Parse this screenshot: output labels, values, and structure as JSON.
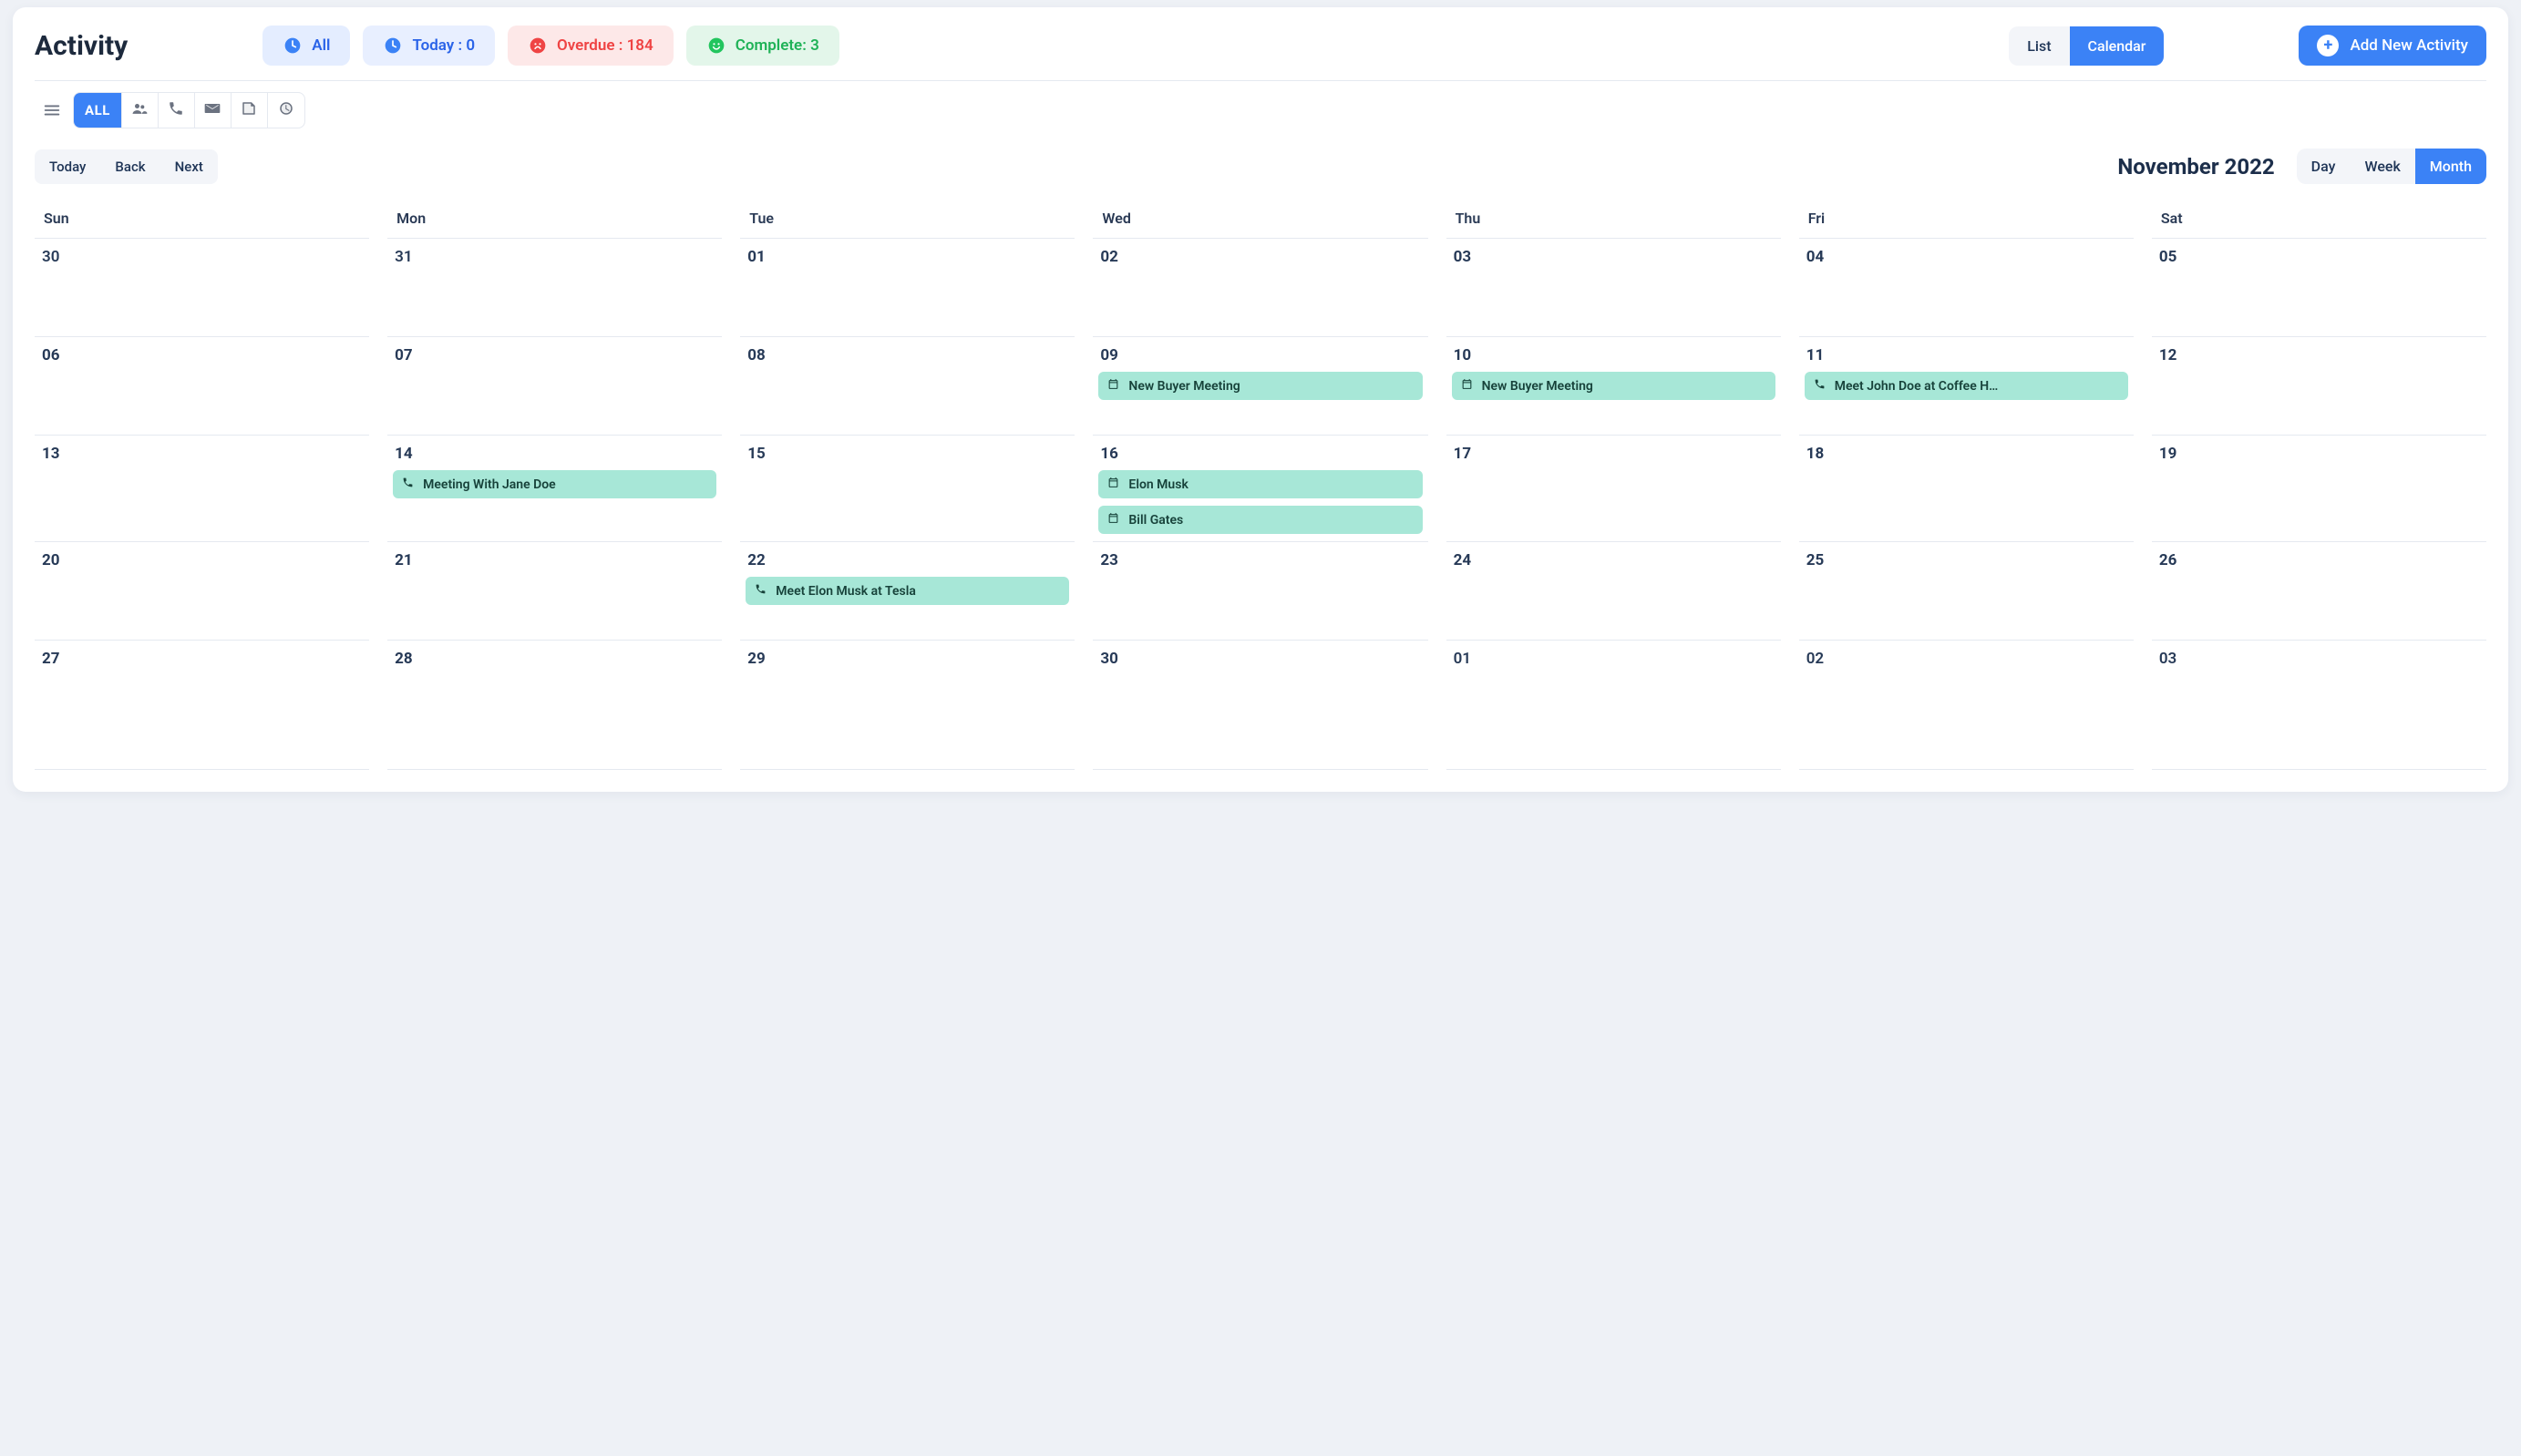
{
  "page_title": "Activity",
  "status_pills": {
    "all": {
      "label": "All"
    },
    "today": {
      "label": "Today : 0"
    },
    "overdue": {
      "label": "Overdue : 184"
    },
    "complete": {
      "label": "Complete: 3"
    }
  },
  "view_toggle": {
    "list": "List",
    "calendar": "Calendar",
    "active": "calendar"
  },
  "add_button": "Add New Activity",
  "type_filter": {
    "all_label": "ALL",
    "active": "all"
  },
  "nav": {
    "today": "Today",
    "back": "Back",
    "next": "Next"
  },
  "month_label": "November 2022",
  "range_toggle": {
    "day": "Day",
    "week": "Week",
    "month": "Month",
    "active": "month"
  },
  "dow": [
    "Sun",
    "Mon",
    "Tue",
    "Wed",
    "Thu",
    "Fri",
    "Sat"
  ],
  "weeks": [
    {
      "tall": false,
      "days": [
        {
          "n": "30",
          "other": true,
          "events": []
        },
        {
          "n": "31",
          "other": true,
          "events": []
        },
        {
          "n": "01",
          "events": []
        },
        {
          "n": "02",
          "events": []
        },
        {
          "n": "03",
          "events": []
        },
        {
          "n": "04",
          "events": []
        },
        {
          "n": "05",
          "events": []
        }
      ]
    },
    {
      "tall": false,
      "days": [
        {
          "n": "06",
          "events": []
        },
        {
          "n": "07",
          "events": []
        },
        {
          "n": "08",
          "events": []
        },
        {
          "n": "09",
          "events": [
            {
              "icon": "calendar",
              "title": "New Buyer Meeting"
            }
          ]
        },
        {
          "n": "10",
          "events": [
            {
              "icon": "calendar",
              "title": "New Buyer Meeting"
            }
          ]
        },
        {
          "n": "11",
          "events": [
            {
              "icon": "phone",
              "title": "Meet John Doe at Coffee H…"
            }
          ]
        },
        {
          "n": "12",
          "events": []
        }
      ]
    },
    {
      "tall": false,
      "days": [
        {
          "n": "13",
          "events": []
        },
        {
          "n": "14",
          "events": [
            {
              "icon": "phone",
              "title": "Meeting With Jane Doe"
            }
          ]
        },
        {
          "n": "15",
          "events": []
        },
        {
          "n": "16",
          "events": [
            {
              "icon": "calendar",
              "title": "Elon Musk"
            },
            {
              "icon": "calendar",
              "title": "Bill Gates"
            }
          ]
        },
        {
          "n": "17",
          "events": []
        },
        {
          "n": "18",
          "events": []
        },
        {
          "n": "19",
          "events": []
        }
      ]
    },
    {
      "tall": false,
      "days": [
        {
          "n": "20",
          "events": []
        },
        {
          "n": "21",
          "events": []
        },
        {
          "n": "22",
          "events": [
            {
              "icon": "phone",
              "title": "Meet Elon Musk at Tesla"
            }
          ]
        },
        {
          "n": "23",
          "events": []
        },
        {
          "n": "24",
          "events": []
        },
        {
          "n": "25",
          "events": []
        },
        {
          "n": "26",
          "events": []
        }
      ]
    },
    {
      "tall": true,
      "days": [
        {
          "n": "27",
          "events": []
        },
        {
          "n": "28",
          "events": []
        },
        {
          "n": "29",
          "events": []
        },
        {
          "n": "30",
          "events": []
        },
        {
          "n": "01",
          "other": true,
          "events": []
        },
        {
          "n": "02",
          "other": true,
          "events": []
        },
        {
          "n": "03",
          "other": true,
          "events": []
        }
      ]
    }
  ]
}
